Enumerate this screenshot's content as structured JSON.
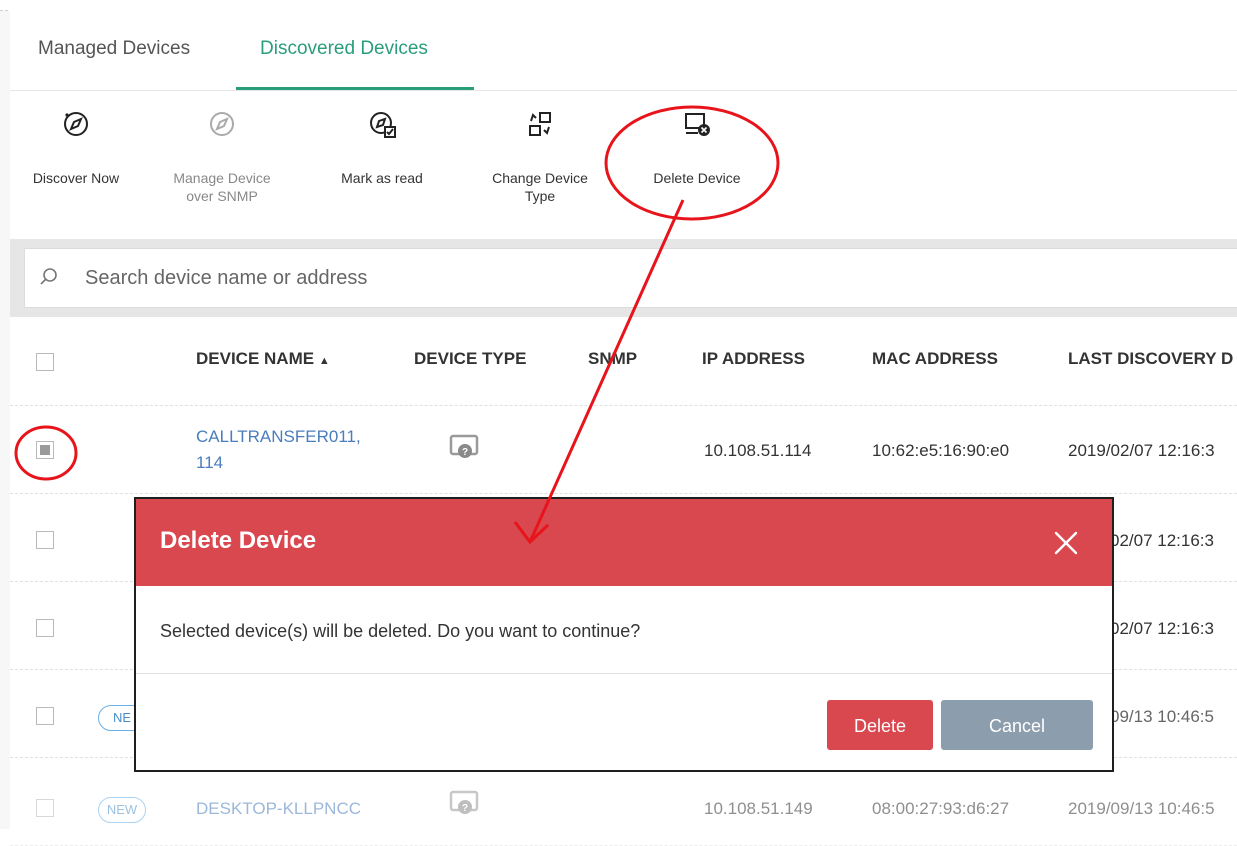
{
  "tabs": {
    "managed": "Managed Devices",
    "discovered": "Discovered Devices"
  },
  "toolbar": {
    "discover_now": "Discover Now",
    "manage_snmp_line1": "Manage Device",
    "manage_snmp_line2": "over SNMP",
    "mark_read": "Mark as read",
    "change_type_line1": "Change Device",
    "change_type_line2": "Type",
    "delete_device": "Delete Device"
  },
  "search": {
    "placeholder": "Search device name or address"
  },
  "table": {
    "headers": {
      "device_name": "DEVICE NAME",
      "device_type": "DEVICE TYPE",
      "snmp": "SNMP",
      "ip": "IP ADDRESS",
      "mac": "MAC ADDRESS",
      "last_discovery": "LAST DISCOVERY D"
    },
    "rows": [
      {
        "name_line1": "CALLTRANSFER011,",
        "name_line2": "114",
        "ip": "10.108.51.114",
        "mac": "10:62:e5:16:90:e0",
        "last": "2019/02/07 12:16:3",
        "checked": true
      },
      {
        "last": "02/07 12:16:3"
      },
      {
        "last": "02/07 12:16:3"
      },
      {
        "badge": "NE",
        "last": "09/13 10:46:5"
      },
      {
        "badge": "NEW",
        "name_line1": "DESKTOP-KLLPNCC",
        "ip": "10.108.51.149",
        "mac": "08:00:27:93:d6:27",
        "last": "2019/09/13 10:46:5"
      }
    ]
  },
  "dialog": {
    "title": "Delete Device",
    "message": "Selected device(s) will be deleted. Do you want to continue?",
    "delete_label": "Delete",
    "cancel_label": "Cancel"
  },
  "colors": {
    "accent": "#2a9d7b",
    "danger": "#d9474f",
    "annotation": "#e8141b",
    "link": "#4a7dbd"
  }
}
